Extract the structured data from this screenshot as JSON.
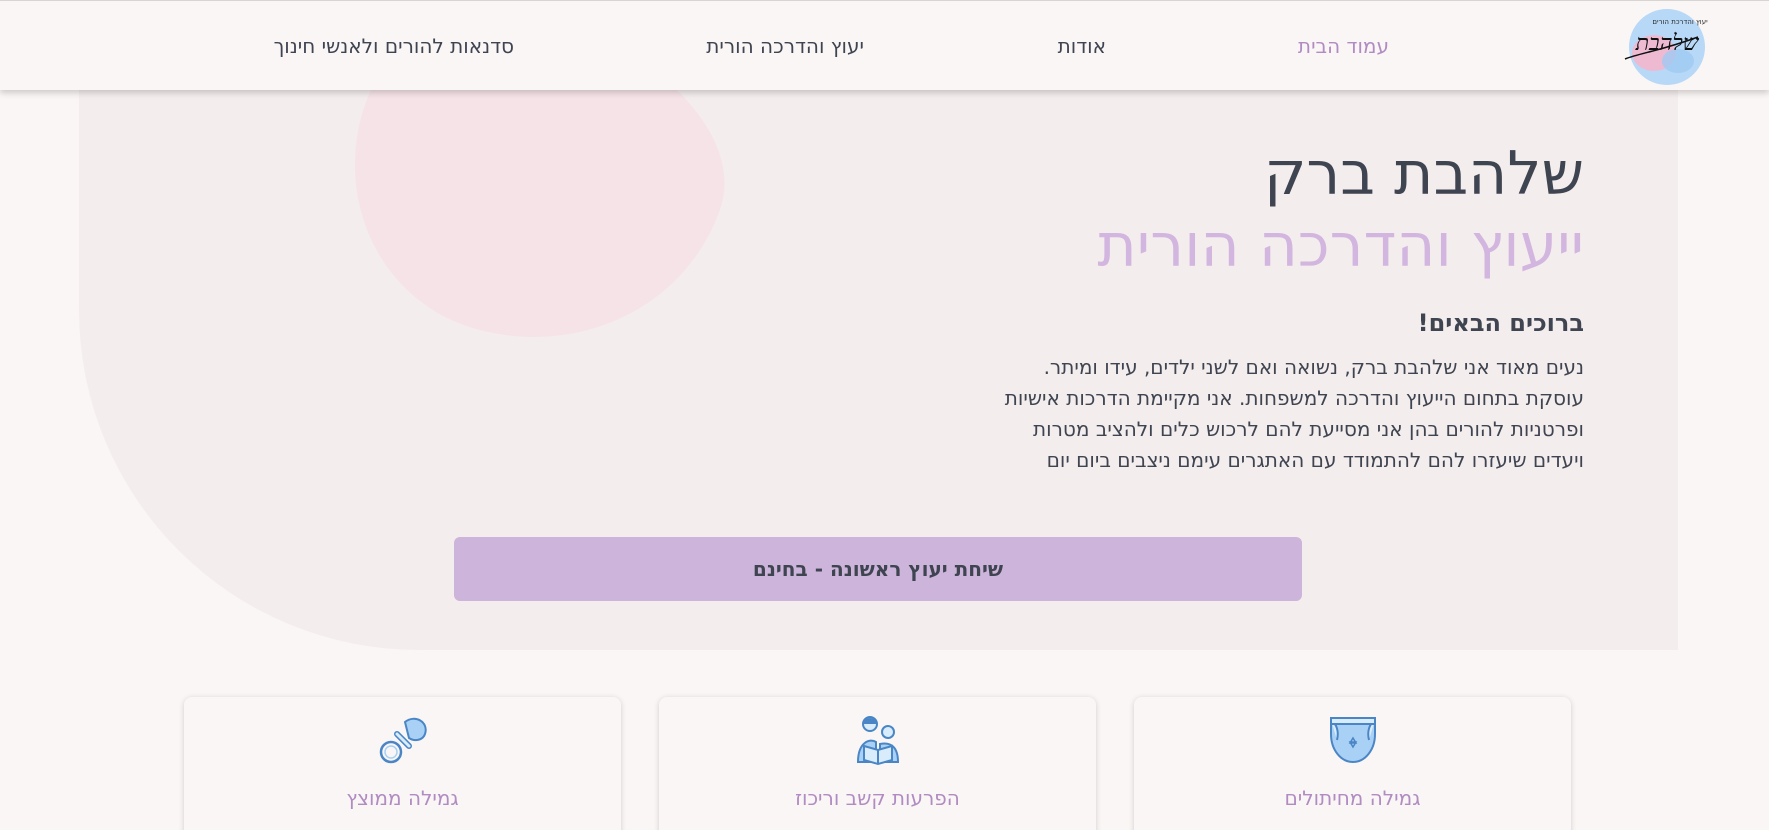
{
  "header": {
    "logo_text": "שלהבת",
    "logo_tagline": "יעוץ והדרכת הורים",
    "nav": [
      {
        "label": "עמוד הבית",
        "active": true
      },
      {
        "label": "אודות"
      },
      {
        "label": "יעוץ והדרכה הורית"
      },
      {
        "label": "סדנאות להורים ולאנשי חינוך"
      }
    ]
  },
  "hero": {
    "title": "שלהבת ברק",
    "subtitle": "ייעוץ והדרכה הורית",
    "welcome": "ברוכים הבאים!",
    "intro_lines": [
      "נעים מאוד אני שלהבת ברק, נשואה ואם לשני ילדים, עידו ומיתר.",
      "עוסקת בתחום הייעוץ והדרכה למשפחות. אני מקיימת הדרכות אישיות",
      "ופרטניות להורים בהן אני מסייעת להם לרכוש כלים ולהציב מטרות",
      "ויעדים שיעזרו להם להתמודד עם האתגרים עימם ניצבים ביום יום"
    ],
    "cta_label": "שיחת יעוץ ראשונה - בחינם"
  },
  "cards": [
    {
      "title": "גמילה מחיתולים",
      "icon": "diaper-icon"
    },
    {
      "title": "הפרעות קשב וריכוז",
      "icon": "parent-reading-child-icon"
    },
    {
      "title": "גמילה ממוצץ",
      "icon": "pacifier-icon"
    }
  ],
  "colors": {
    "accent": "#b08cc2",
    "cta_bg": "#cdb4da",
    "subtitle": "#d2b6df",
    "text": "#3f4451",
    "icon_blue": "#4a86c5",
    "icon_fill": "#a9d0f5"
  }
}
